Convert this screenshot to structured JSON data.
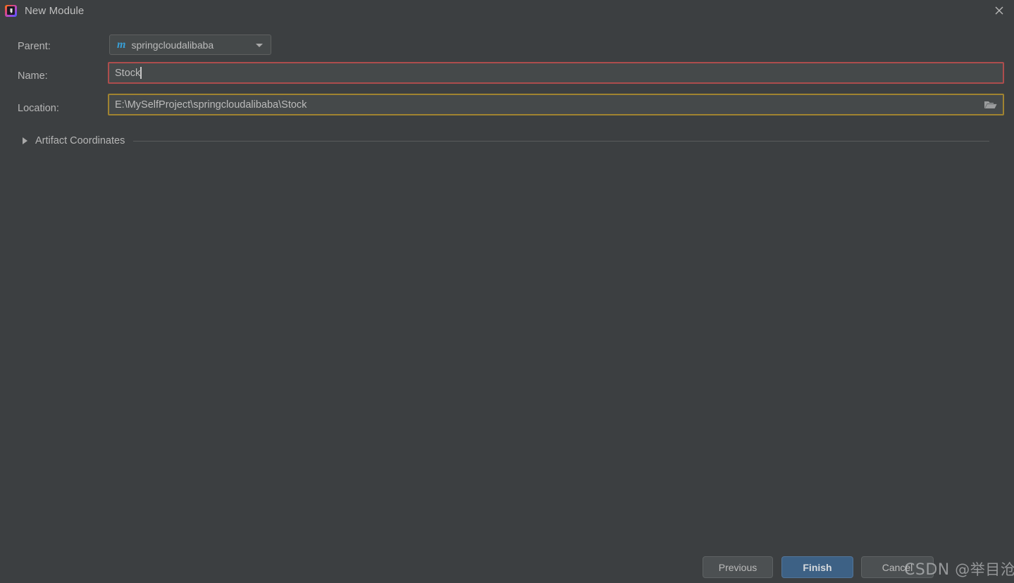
{
  "window": {
    "title": "New Module",
    "app_icon": "intellij-idea-icon",
    "close_icon": "close-icon",
    "background_color": "#3c3f41"
  },
  "form": {
    "parent": {
      "label": "Parent:",
      "value": "springcloudalibaba",
      "icon": "maven-module-icon",
      "icon_glyph": "m",
      "icon_color": "#389fd6",
      "dropdown_icon": "chevron-down-icon"
    },
    "name": {
      "label": "Name:",
      "value": "Stock",
      "border_color": "#ad4d4d",
      "state": "error"
    },
    "location": {
      "label": "Location:",
      "value": "E:\\MySelfProject\\springcloudalibaba\\Stock",
      "browse_icon": "folder-icon",
      "border_color": "#a08330",
      "state": "warning"
    },
    "artifact_coordinates": {
      "label": "Artifact Coordinates",
      "expander_icon": "chevron-right-icon",
      "expanded": false
    }
  },
  "footer": {
    "previous_label": "Previous",
    "finish_label": "Finish",
    "cancel_label": "Cancel",
    "finish_color": "#3d6185"
  },
  "watermark": {
    "brand": "CSDN ",
    "handle": "@举目沧桑"
  }
}
